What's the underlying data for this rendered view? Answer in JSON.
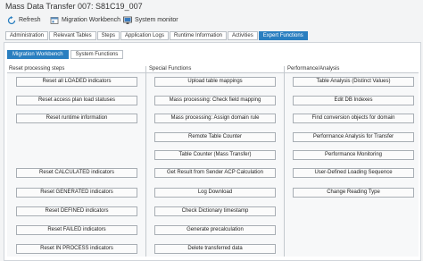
{
  "window": {
    "title": "Mass Data Transfer 007: S81C19_007"
  },
  "toolbar": {
    "refresh": "Refresh",
    "migration_workbench": "Migration Workbench",
    "system_monitor": "System monitor"
  },
  "tabs": [
    "Administration",
    "Relevant Tables",
    "Steps",
    "Application Logs",
    "Runtime Information",
    "Activities",
    "Expert Functions"
  ],
  "subtabs": [
    "Migration Workbench",
    "System Functions"
  ],
  "sections": {
    "reset": {
      "title": "Reset processing steps",
      "buttons": [
        "Reset all LOADED indicators",
        "Reset access plan load statuses",
        "Reset runtime information",
        "Reset CALCULATED indicators",
        "Reset GENERATED indicators",
        "Reset DEFINED indicators",
        "Reset FAILED indicators",
        "Reset IN PROCESS indicators"
      ]
    },
    "special": {
      "title": "Special Functions",
      "buttons": [
        "Upload table mappings",
        "Mass processing: Check field mapping",
        "Mass processing: Assign domain rule",
        "Remote Table Counter",
        "Table Counter (Mass Transfer)",
        "Get Result from Sender ACP Calculation",
        "Log Download",
        "Check Dictionary timestamp",
        "Generate precalculation",
        "Delete transferred data"
      ]
    },
    "performance": {
      "title": "Performance/Analysis",
      "buttons": [
        "Table Analysis (Distinct Values)",
        "Edit DB Indexes",
        "Find conversion objects for domain",
        "Performance Analysis for Transfer",
        "Performance Monitoring",
        "User-Defined Loading Sequence",
        "Change Reading Type"
      ]
    }
  },
  "colors": {
    "accent": "#2a7fc0",
    "button_border": "#a8aeb4"
  }
}
